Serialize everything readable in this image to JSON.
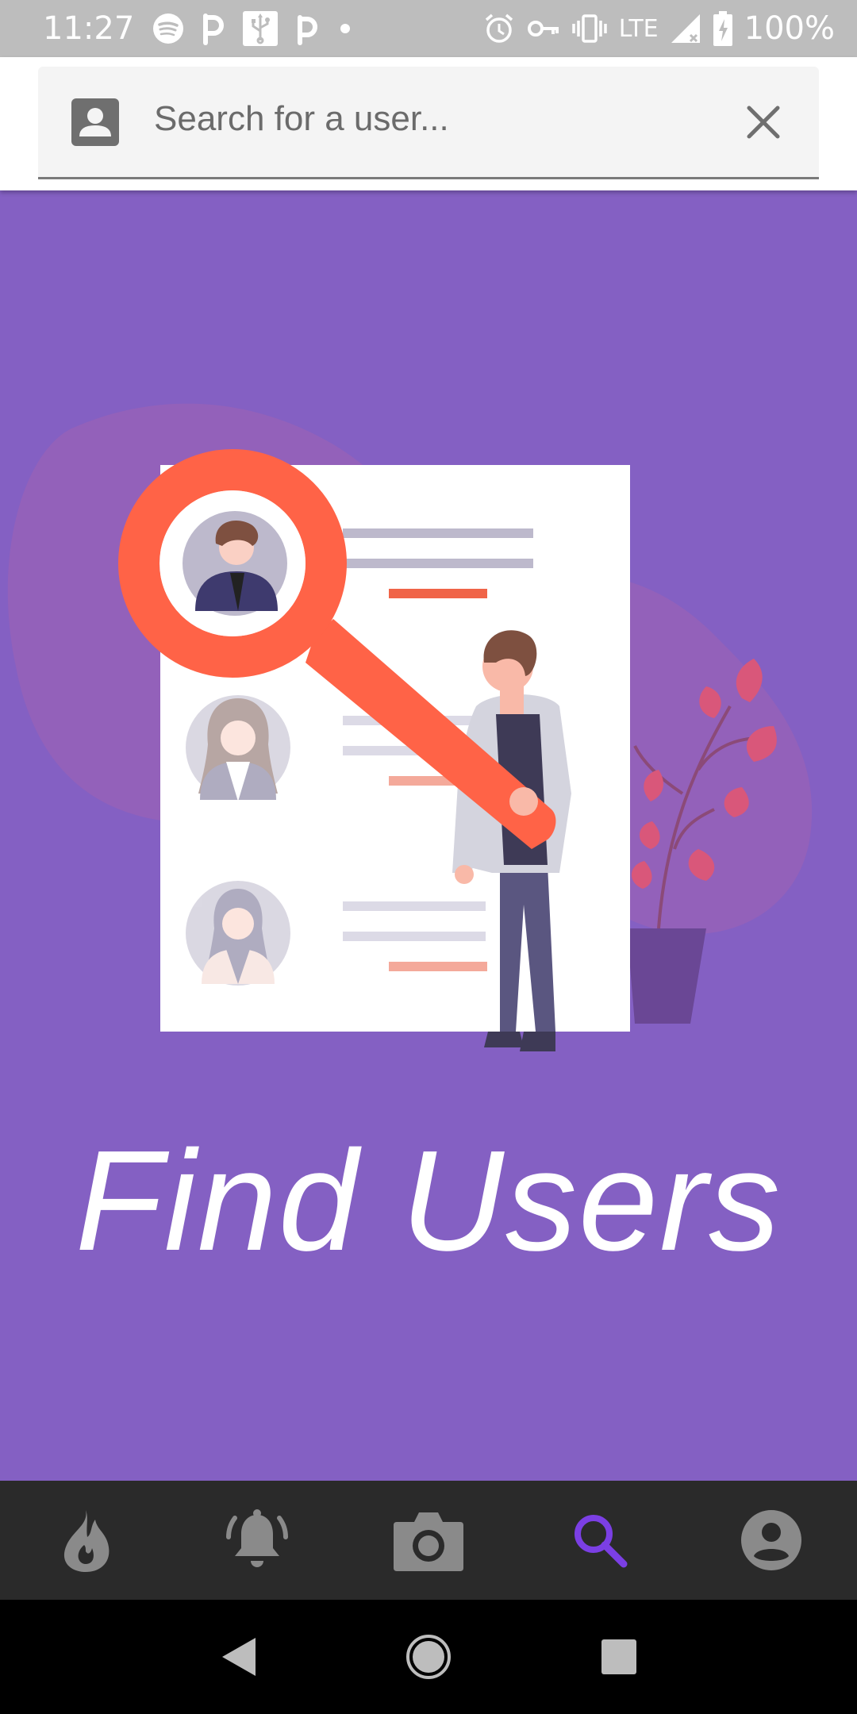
{
  "status_bar": {
    "time": "11:27",
    "network": "LTE",
    "battery": "100%",
    "left_icons": [
      "spotify-icon",
      "p-app-icon",
      "usb-icon",
      "p-app-icon",
      "dot-icon"
    ],
    "right_icons": [
      "alarm-icon",
      "key-icon",
      "vibrate-icon",
      "lte-signal-icon",
      "battery-charging-icon"
    ]
  },
  "search": {
    "placeholder": "Search for a user...",
    "value": "",
    "leading_icon": "contact-icon",
    "clear_icon": "close-icon"
  },
  "main": {
    "heading": "Find Users",
    "illustration": "find-users-illustration"
  },
  "bottom_nav": {
    "items": [
      {
        "name": "fire",
        "icon": "fire-icon",
        "active": false
      },
      {
        "name": "notifications",
        "icon": "bell-icon",
        "active": false
      },
      {
        "name": "camera",
        "icon": "camera-icon",
        "active": false
      },
      {
        "name": "search",
        "icon": "search-icon",
        "active": true
      },
      {
        "name": "profile",
        "icon": "account-icon",
        "active": false
      }
    ]
  },
  "system_nav": {
    "buttons": [
      "back-icon",
      "home-icon",
      "recents-icon"
    ]
  },
  "colors": {
    "background": "#8460C3",
    "status_bar": "#BDBDBD",
    "accent": "#FF6347",
    "nav_bar": "#2A2A2A",
    "nav_active": "#7B3FE4",
    "nav_inactive": "#8A8A8A"
  }
}
